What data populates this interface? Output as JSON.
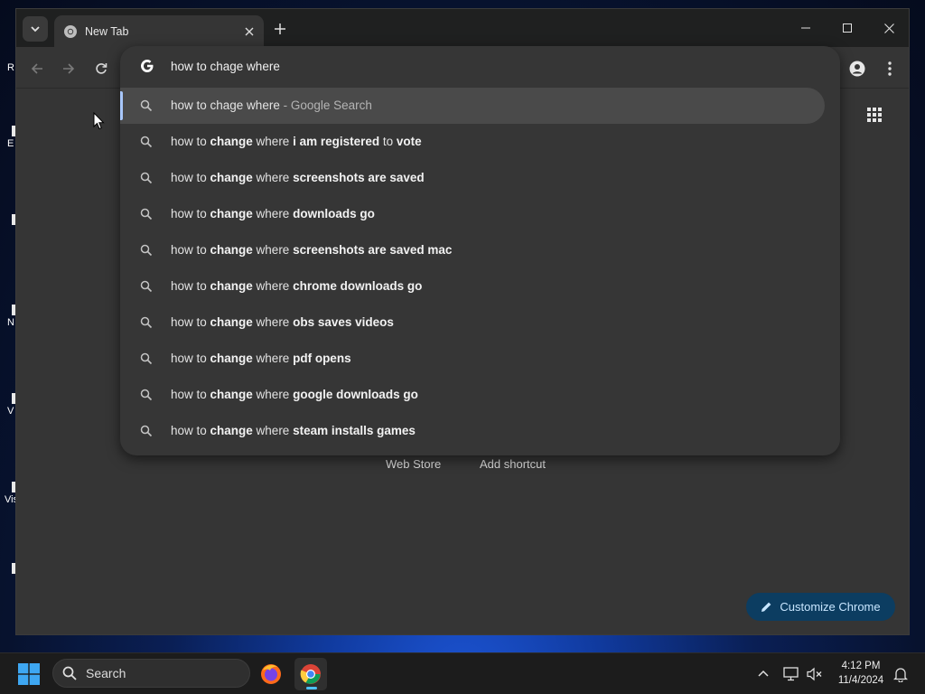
{
  "desktop": {
    "icon_labels": [
      "R",
      "E",
      "",
      "N",
      "V",
      "",
      "Vis",
      ""
    ]
  },
  "browser": {
    "tab": {
      "title": "New Tab"
    },
    "omnibox": {
      "query": "how to chage where",
      "suggestions": [
        {
          "parts": [
            {
              "t": "how to chage where",
              "b": false
            }
          ],
          "suffix": " - Google Search",
          "selected": true
        },
        {
          "parts": [
            {
              "t": "how to ",
              "b": false
            },
            {
              "t": "change",
              "b": true
            },
            {
              "t": " where ",
              "b": false
            },
            {
              "t": "i am registered",
              "b": true
            },
            {
              "t": " to ",
              "b": false
            },
            {
              "t": "vote",
              "b": true
            }
          ],
          "suffix": ""
        },
        {
          "parts": [
            {
              "t": "how to ",
              "b": false
            },
            {
              "t": "change",
              "b": true
            },
            {
              "t": " where ",
              "b": false
            },
            {
              "t": "screenshots are saved",
              "b": true
            }
          ],
          "suffix": ""
        },
        {
          "parts": [
            {
              "t": "how to ",
              "b": false
            },
            {
              "t": "change",
              "b": true
            },
            {
              "t": " where ",
              "b": false
            },
            {
              "t": "downloads go",
              "b": true
            }
          ],
          "suffix": ""
        },
        {
          "parts": [
            {
              "t": "how to ",
              "b": false
            },
            {
              "t": "change",
              "b": true
            },
            {
              "t": " where ",
              "b": false
            },
            {
              "t": "screenshots are saved mac",
              "b": true
            }
          ],
          "suffix": ""
        },
        {
          "parts": [
            {
              "t": "how to ",
              "b": false
            },
            {
              "t": "change",
              "b": true
            },
            {
              "t": " where ",
              "b": false
            },
            {
              "t": "chrome downloads go",
              "b": true
            }
          ],
          "suffix": ""
        },
        {
          "parts": [
            {
              "t": "how to ",
              "b": false
            },
            {
              "t": "change",
              "b": true
            },
            {
              "t": " where ",
              "b": false
            },
            {
              "t": "obs saves videos",
              "b": true
            }
          ],
          "suffix": ""
        },
        {
          "parts": [
            {
              "t": "how to ",
              "b": false
            },
            {
              "t": "change",
              "b": true
            },
            {
              "t": " where ",
              "b": false
            },
            {
              "t": "pdf opens",
              "b": true
            }
          ],
          "suffix": ""
        },
        {
          "parts": [
            {
              "t": "how to ",
              "b": false
            },
            {
              "t": "change",
              "b": true
            },
            {
              "t": " where ",
              "b": false
            },
            {
              "t": "google downloads go",
              "b": true
            }
          ],
          "suffix": ""
        },
        {
          "parts": [
            {
              "t": "how to ",
              "b": false
            },
            {
              "t": "change",
              "b": true
            },
            {
              "t": " where ",
              "b": false
            },
            {
              "t": "steam installs games",
              "b": true
            }
          ],
          "suffix": ""
        }
      ]
    },
    "page": {
      "links": [
        "Web Store",
        "Add shortcut"
      ],
      "customize_label": "Customize Chrome"
    }
  },
  "taskbar": {
    "search_label": "Search",
    "time": "4:12 PM",
    "date": "11/4/2024"
  },
  "colors": {
    "accent": "#a8c7fa",
    "customize_bg": "#0c3d61",
    "taskbar_indicator": "#4cc2ff"
  },
  "icons": [
    "chrome-icon",
    "google-g-icon",
    "search-icon",
    "back-arrow-icon",
    "forward-arrow-icon",
    "reload-icon",
    "profile-icon",
    "kebab-menu-icon",
    "apps-grid-icon",
    "pencil-icon",
    "windows-start-icon",
    "firefox-icon",
    "chevron-up-icon",
    "network-icon",
    "volume-muted-icon",
    "bell-icon"
  ]
}
